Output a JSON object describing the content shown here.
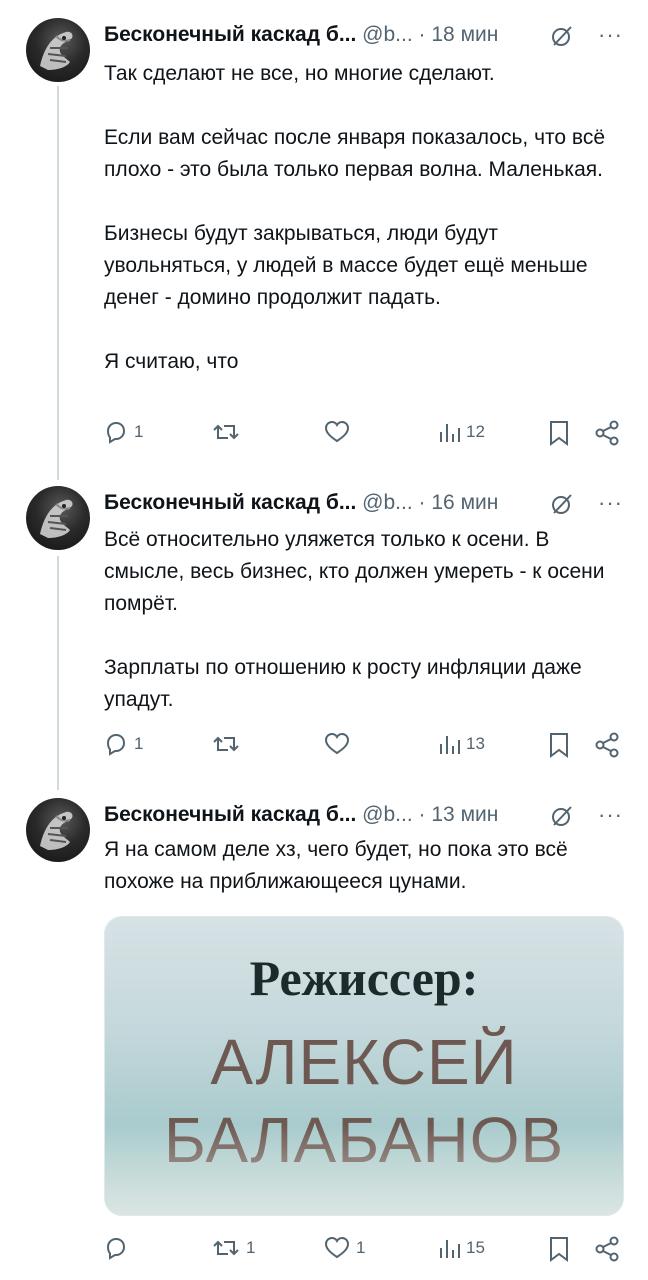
{
  "tweets": [
    {
      "author": "Бесконечный каскад б...",
      "handle": "@b...",
      "dot": "·",
      "time": "18 мин",
      "more": "···",
      "paragraphs": [
        "Так сделают не все, но многие сделают.",
        "Если вам сейчас после января показалось, что всё плохо - это была только первая волна. Маленькая.",
        "Бизнесы будут закрываться, люди будут увольняться, у людей в массе будет ещё меньше денег - домино продолжит падать.",
        "Я считаю, что"
      ],
      "replies": "1",
      "reposts": "",
      "likes": "",
      "views": "12"
    },
    {
      "author": "Бесконечный каскад б...",
      "handle": "@b...",
      "dot": "·",
      "time": "16 мин",
      "more": "···",
      "paragraphs": [
        "Всё относительно уляжется только к осени. В смысле, весь бизнес, кто должен умереть - к осени помрёт.",
        "Зарплаты по отношению к росту инфляции даже упадут."
      ],
      "replies": "1",
      "reposts": "",
      "likes": "",
      "views": "13"
    },
    {
      "author": "Бесконечный каскад б...",
      "handle": "@b...",
      "dot": "·",
      "time": "13 мин",
      "more": "···",
      "paragraphs": [
        "Я на самом деле хз, чего будет, но пока это всё похоже на приближающееся цунами."
      ],
      "media": {
        "line1": "Режиссер:",
        "line2": "АЛЕКСЕЙ",
        "line3": "БАЛАБАНОВ"
      },
      "replies": "",
      "reposts": "1",
      "likes": "1",
      "views": "15"
    }
  ],
  "icons": {
    "reply": "reply-icon",
    "repost": "repost-icon",
    "like": "heart-icon",
    "views": "views-icon",
    "bookmark": "bookmark-icon",
    "share": "share-icon",
    "grok": "grok-icon",
    "more": "more-icon"
  },
  "colors": {
    "text": "#0f1419",
    "secondary": "#536471",
    "thread_line": "#cfd9de"
  }
}
